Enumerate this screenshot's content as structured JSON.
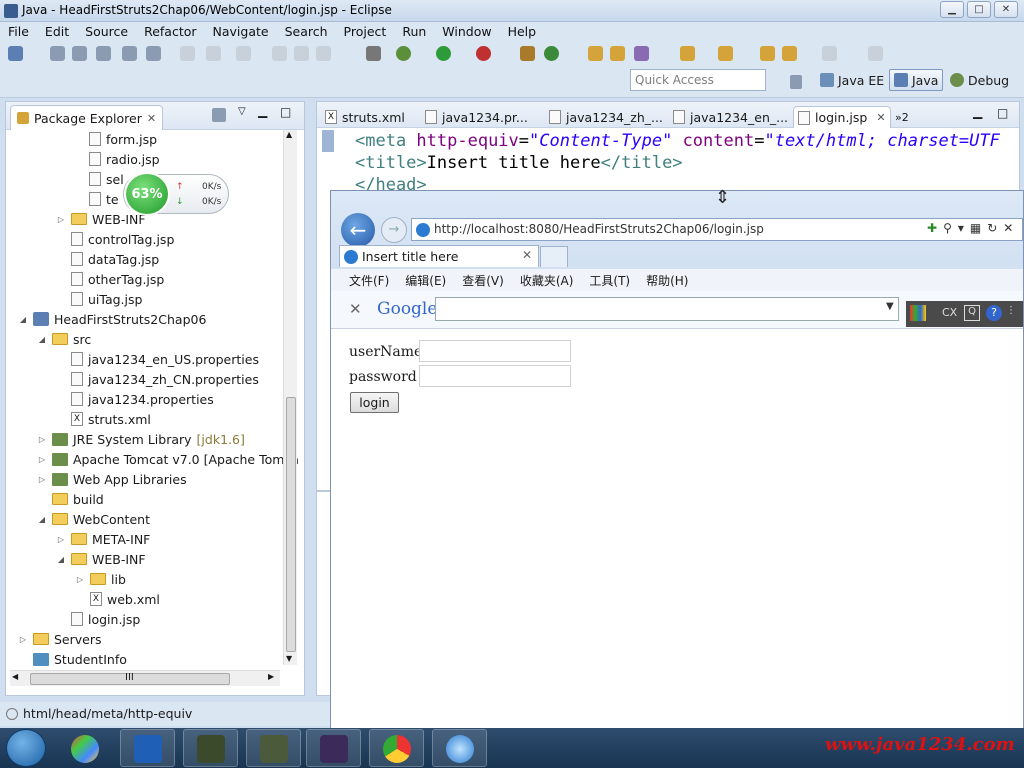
{
  "window": {
    "title": "Java - HeadFirstStruts2Chap06/WebContent/login.jsp - Eclipse"
  },
  "menubar": [
    "File",
    "Edit",
    "Source",
    "Refactor",
    "Navigate",
    "Search",
    "Project",
    "Run",
    "Window",
    "Help"
  ],
  "toolbar": {
    "quick_access_placeholder": "Quick Access",
    "perspectives": [
      "Java EE",
      "Java",
      "Debug"
    ]
  },
  "package_explorer": {
    "tab_label": "Package Explorer",
    "items": [
      "form.jsp",
      "radio.jsp",
      "sel",
      "te",
      "WEB-INF",
      "controlTag.jsp",
      "dataTag.jsp",
      "otherTag.jsp",
      "uiTag.jsp",
      "HeadFirstStruts2Chap06",
      "src",
      "java1234_en_US.properties",
      "java1234_zh_CN.properties",
      "java1234.properties",
      "struts.xml",
      "JRE System Library",
      "Apache Tomcat v7.0 [Apache Tomca",
      "Web App Libraries",
      "build",
      "WebContent",
      "META-INF",
      "WEB-INF",
      "lib",
      "web.xml",
      "login.jsp",
      "Servers",
      "StudentInfo"
    ],
    "jre_suffix": "[jdk1.6]",
    "hscroll_grip": "III"
  },
  "net_widget": {
    "percent": "63%",
    "up": "0K/s",
    "down": "0K/s"
  },
  "editor": {
    "tabs": [
      "struts.xml",
      "java1234.pr...",
      "java1234_zh_...",
      "java1234_en_...",
      "login.jsp"
    ],
    "overflow": "»2",
    "code": {
      "line1": {
        "open": "<meta ",
        "a1": "http-equiv",
        "eq1": "=",
        "v1": "\"Content-Type\"",
        "a2": " content",
        "eq2": "=",
        "v2": "\"text/html; charset=UTF"
      },
      "line2": {
        "open": "<title>",
        "text": "Insert title here",
        "close": "</title>"
      },
      "line3": {
        "close": "</head>"
      }
    }
  },
  "browser": {
    "address": "http://localhost:8080/HeadFirstStruts2Chap06/login.jsp",
    "tab_title": "Insert title here",
    "menu": [
      "文件(F)",
      "编辑(E)",
      "查看(V)",
      "收藏夹(A)",
      "工具(T)",
      "帮助(H)"
    ],
    "google_label": "Google",
    "form": {
      "username_label": "userName",
      "password_label": "password",
      "submit_label": "login"
    }
  },
  "statusbar": {
    "text": "html/head/meta/http-equiv"
  },
  "watermark": "www.java1234.com",
  "colors": {
    "chrome": "#dbe6f3",
    "tag": "#3f7f7f",
    "attr": "#7f007f",
    "value": "#2a00ff",
    "taskbar": "#183452"
  }
}
